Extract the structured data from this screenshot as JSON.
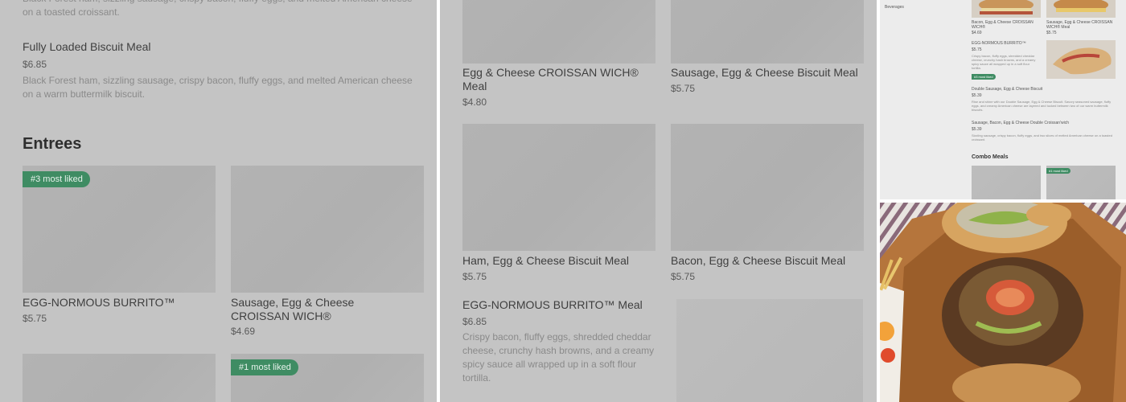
{
  "left_panel": {
    "partial_desc": "Black Forest ham, sizzling sausage, crispy bacon, fluffy eggs, and melted American cheese on a toasted croissant.",
    "loaded_biscuit": {
      "title": "Fully Loaded Biscuit Meal",
      "price": "$6.85",
      "desc": "Black Forest ham, sizzling sausage, crispy bacon, fluffy eggs, and melted American cheese on a warm buttermilk biscuit."
    },
    "section_title": "Entrees",
    "items": [
      {
        "title": "EGG-NORMOUS BURRITO™",
        "price": "$5.75",
        "badge": "#3 most liked"
      },
      {
        "title": "Sausage, Egg & Cheese CROISSAN WICH®",
        "price": "$4.69"
      }
    ],
    "bottom_badge": "#1 most liked"
  },
  "middle_panel": {
    "items": [
      {
        "title": "Egg & Cheese CROISSAN WICH® Meal",
        "price": "$4.80"
      },
      {
        "title": "Sausage, Egg & Cheese Biscuit Meal",
        "price": "$5.75"
      },
      {
        "title": "Ham, Egg & Cheese Biscuit Meal",
        "price": "$5.75"
      },
      {
        "title": "Bacon, Egg & Cheese Biscuit Meal",
        "price": "$5.75"
      }
    ],
    "burrito_meal": {
      "title": "EGG-NORMOUS BURRITO™ Meal",
      "price": "$6.85",
      "desc": "Crispy bacon, fluffy eggs, shredded cheddar cheese, crunchy hash browns, and a creamy spicy sauce all wrapped up in a soft flour tortilla."
    }
  },
  "mini_screenshot": {
    "sidebar_item": "Beverages",
    "item1_title": "Bacon, Egg & Cheese CROISSAN WICH®",
    "item1_price": "$4.69",
    "item2_title": "Sausage, Egg & Cheese CROISSAN WICH® Meal",
    "item2_price": "$5.75",
    "burrito_title": "EGG-NORMOUS BURRITO™",
    "burrito_price": "$5.75",
    "burrito_desc": "Crispy bacon, fluffy eggs, shredded cheddar cheese, crunchy hash browns, and a creamy spicy sauce all wrapped up in a soft flour tortilla.",
    "burrito_badge": "#3 most liked",
    "double_title": "Double Sausage, Egg & Cheese Biscuit",
    "double_price": "$5.39",
    "double_desc": "Rise and shine with our Double Sausage, Egg & Cheese Biscuit. Savory seasoned sausage, fluffy eggs, and creamy American cheese are layered and tucked between two of our warm buttermilk biscuits.",
    "double_crois_title": "Sausage, Bacon, Egg & Cheese Double Croissan'wich",
    "double_crois_price": "$5.39",
    "double_crois_desc": "Sizzling sausage, crispy bacon, fluffy eggs, and two slices of melted American cheese on a toasted croissant.",
    "combo_title": "Combo Meals",
    "combo_badge": "#1 most liked"
  },
  "colors": {
    "badge": "#3f8c63",
    "overlay": "#c4c4c4"
  }
}
